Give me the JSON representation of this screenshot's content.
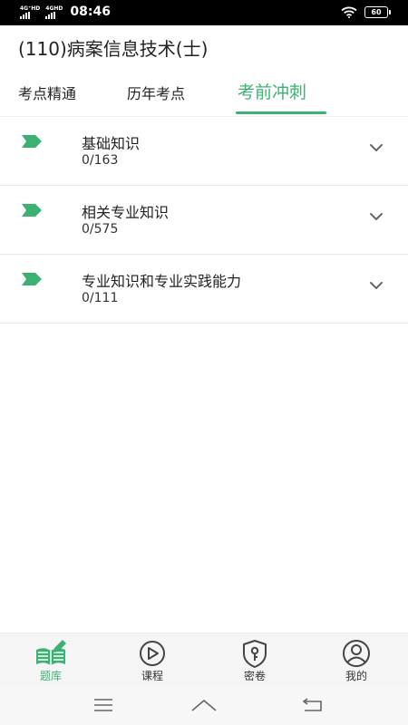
{
  "status_bar": {
    "signal_label_1": "4G⁺HD",
    "signal_label_2": "4GHD",
    "time": "08:46",
    "battery": "60"
  },
  "page_title": "(110)病案信息技术(士)",
  "tabs": [
    {
      "label": "考点精通",
      "active": false
    },
    {
      "label": "历年考点",
      "active": false
    },
    {
      "label": "考前冲刺",
      "active": true
    }
  ],
  "items": [
    {
      "name": "基础知识",
      "progress": "0/163"
    },
    {
      "name": "相关专业知识",
      "progress": "0/575"
    },
    {
      "name": "专业知识和专业实践能力",
      "progress": "0/111"
    }
  ],
  "bottom_nav": [
    {
      "label": "题库",
      "icon": "book-pen-icon",
      "active": true
    },
    {
      "label": "课程",
      "icon": "play-circle-icon",
      "active": false
    },
    {
      "label": "密卷",
      "icon": "lock-shield-icon",
      "active": false
    },
    {
      "label": "我的",
      "icon": "user-circle-icon",
      "active": false
    }
  ],
  "colors": {
    "accent": "#3bb273",
    "text": "#222222"
  }
}
